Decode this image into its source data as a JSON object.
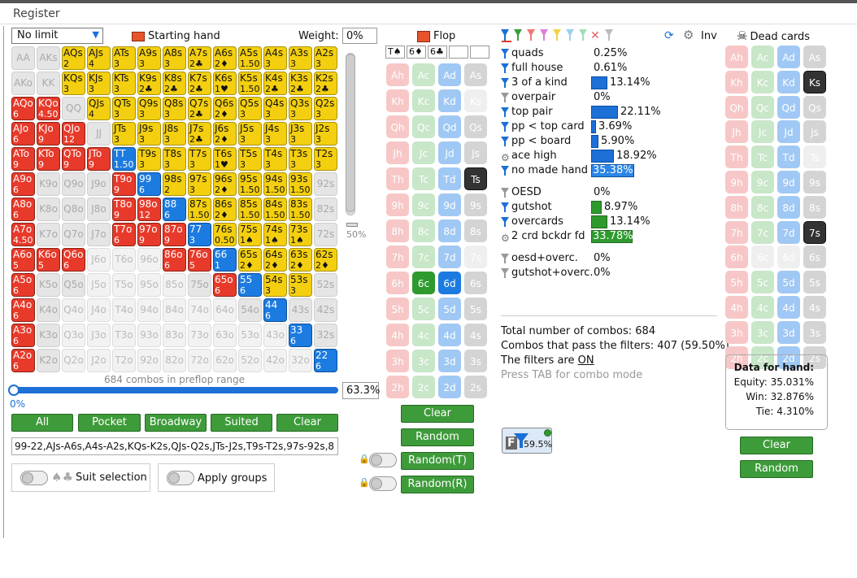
{
  "app": {
    "menu": "Register"
  },
  "controls": {
    "limit": "No limit",
    "starting_hand": "Starting hand",
    "weight_label": "Weight:",
    "weight_value": "0%",
    "percent": "50%",
    "combos_text": "684 combos in preflop range",
    "range_pct": "63.3%",
    "slider_left": "0%",
    "range_string": "99-22,AJs-A6s,A4s-A2s,KQs-K2s,QJs-Q2s,JTs-J2s,T9s-T2s,97s-92s,8",
    "suit_selection": "Suit selection",
    "apply_groups": "Apply groups"
  },
  "buttons": {
    "all": "All",
    "pocket": "Pocket",
    "broadway": "Broadway",
    "suited": "Suited",
    "clear": "Clear",
    "board_clear": "Clear",
    "board_random": "Random",
    "random_t": "Random(T)",
    "random_r": "Random(R)",
    "dead_clear": "Clear",
    "dead_random": "Random"
  },
  "flop": {
    "label": "Flop",
    "cards": [
      "T♠",
      "6♦",
      "6♣",
      "",
      ""
    ]
  },
  "grid": [
    [
      [
        "AA",
        "",
        "gray"
      ],
      [
        "AKs",
        "",
        "gray"
      ],
      [
        "AQs",
        "2",
        "yellow"
      ],
      [
        "AJs",
        "4",
        "yellow"
      ],
      [
        "ATs",
        "3",
        "yellow"
      ],
      [
        "A9s",
        "3",
        "yellow"
      ],
      [
        "A8s",
        "3",
        "yellow"
      ],
      [
        "A7s",
        "2♣",
        "yellow"
      ],
      [
        "A6s",
        "2♦",
        "yellow"
      ],
      [
        "A5s",
        "1.50",
        "yellow"
      ],
      [
        "A4s",
        "3",
        "yellow"
      ],
      [
        "A3s",
        "3",
        "yellow"
      ],
      [
        "A2s",
        "3",
        "yellow"
      ]
    ],
    [
      [
        "AKo",
        "",
        "gray"
      ],
      [
        "KK",
        "",
        "gray"
      ],
      [
        "KQs",
        "3",
        "yellow"
      ],
      [
        "KJs",
        "3",
        "yellow"
      ],
      [
        "KTs",
        "3",
        "yellow"
      ],
      [
        "K9s",
        "2♣",
        "yellow"
      ],
      [
        "K8s",
        "2♣",
        "yellow"
      ],
      [
        "K7s",
        "2♣",
        "yellow"
      ],
      [
        "K6s",
        "1♥",
        "yellow"
      ],
      [
        "K5s",
        "1.50",
        "yellow"
      ],
      [
        "K4s",
        "2♣",
        "yellow"
      ],
      [
        "K3s",
        "2♣",
        "yellow"
      ],
      [
        "K2s",
        "2♣",
        "yellow"
      ]
    ],
    [
      [
        "AQo",
        "6",
        "red"
      ],
      [
        "KQo",
        "4.50",
        "red"
      ],
      [
        "QQ",
        "",
        "gray"
      ],
      [
        "QJs",
        "4",
        "yellow"
      ],
      [
        "QTs",
        "3",
        "yellow"
      ],
      [
        "Q9s",
        "3",
        "yellow"
      ],
      [
        "Q8s",
        "3",
        "yellow"
      ],
      [
        "Q7s",
        "2♣",
        "yellow"
      ],
      [
        "Q6s",
        "2♦",
        "yellow"
      ],
      [
        "Q5s",
        "3",
        "yellow"
      ],
      [
        "Q4s",
        "3",
        "yellow"
      ],
      [
        "Q3s",
        "3",
        "yellow"
      ],
      [
        "Q2s",
        "3",
        "yellow"
      ]
    ],
    [
      [
        "AJo",
        "6",
        "red"
      ],
      [
        "KJo",
        "9",
        "red"
      ],
      [
        "QJo",
        "12",
        "red"
      ],
      [
        "JJ",
        "",
        "gray"
      ],
      [
        "JTs",
        "3",
        "yellow"
      ],
      [
        "J9s",
        "3",
        "yellow"
      ],
      [
        "J8s",
        "3",
        "yellow"
      ],
      [
        "J7s",
        "2♣",
        "yellow"
      ],
      [
        "J6s",
        "2♦",
        "yellow"
      ],
      [
        "J5s",
        "3",
        "yellow"
      ],
      [
        "J4s",
        "3",
        "yellow"
      ],
      [
        "J3s",
        "3",
        "yellow"
      ],
      [
        "J2s",
        "3",
        "yellow"
      ]
    ],
    [
      [
        "ATo",
        "9",
        "red"
      ],
      [
        "KTo",
        "9",
        "red"
      ],
      [
        "QTo",
        "9",
        "red"
      ],
      [
        "JTo",
        "9",
        "red"
      ],
      [
        "TT",
        "1.50",
        "blue"
      ],
      [
        "T9s",
        "3",
        "yellow"
      ],
      [
        "T8s",
        "3",
        "yellow"
      ],
      [
        "T7s",
        "3",
        "yellow"
      ],
      [
        "T6s",
        "1♥",
        "yellow"
      ],
      [
        "T5s",
        "3",
        "yellow"
      ],
      [
        "T4s",
        "3",
        "yellow"
      ],
      [
        "T3s",
        "3",
        "yellow"
      ],
      [
        "T2s",
        "3",
        "yellow"
      ]
    ],
    [
      [
        "A9o",
        "6",
        "red"
      ],
      [
        "K9o",
        "",
        "gray"
      ],
      [
        "Q9o",
        "",
        "gray"
      ],
      [
        "J9o",
        "",
        "gray"
      ],
      [
        "T9o",
        "9",
        "red"
      ],
      [
        "99",
        "6",
        "blue"
      ],
      [
        "98s",
        "2",
        "yellow"
      ],
      [
        "97s",
        "3",
        "yellow"
      ],
      [
        "96s",
        "2♦",
        "yellow"
      ],
      [
        "95s",
        "1.50",
        "yellow"
      ],
      [
        "94s",
        "1.50",
        "yellow"
      ],
      [
        "93s",
        "1.50",
        "yellow"
      ],
      [
        "92s",
        "",
        "gray"
      ]
    ],
    [
      [
        "A8o",
        "6",
        "red"
      ],
      [
        "K8o",
        "",
        "gray"
      ],
      [
        "Q8o",
        "",
        "gray"
      ],
      [
        "J8o",
        "",
        "gray"
      ],
      [
        "T8o",
        "9",
        "red"
      ],
      [
        "98o",
        "12",
        "red"
      ],
      [
        "88",
        "6",
        "blue"
      ],
      [
        "87s",
        "1.50",
        "yellow"
      ],
      [
        "86s",
        "2♦",
        "yellow"
      ],
      [
        "85s",
        "1.50",
        "yellow"
      ],
      [
        "84s",
        "1.50",
        "yellow"
      ],
      [
        "83s",
        "1.50",
        "yellow"
      ],
      [
        "82s",
        "",
        "gray"
      ]
    ],
    [
      [
        "A7o",
        "4.50",
        "red"
      ],
      [
        "K7o",
        "",
        "gray"
      ],
      [
        "Q7o",
        "",
        "gray"
      ],
      [
        "J7o",
        "",
        "gray"
      ],
      [
        "T7o",
        "6",
        "red"
      ],
      [
        "97o",
        "9",
        "red"
      ],
      [
        "87o",
        "9",
        "red"
      ],
      [
        "77",
        "3",
        "blue"
      ],
      [
        "76s",
        "0.50",
        "yellow"
      ],
      [
        "75s",
        "1♠",
        "yellow"
      ],
      [
        "74s",
        "1♠",
        "yellow"
      ],
      [
        "73s",
        "1♠",
        "yellow"
      ],
      [
        "72s",
        "",
        "gray"
      ]
    ],
    [
      [
        "A6o",
        "5",
        "red"
      ],
      [
        "K6o",
        "5",
        "red"
      ],
      [
        "Q6o",
        "6",
        "red"
      ],
      [
        "J6o",
        "",
        "light"
      ],
      [
        "T6o",
        "",
        "light"
      ],
      [
        "96o",
        "",
        "light"
      ],
      [
        "86o",
        "6",
        "red"
      ],
      [
        "76o",
        "5",
        "red"
      ],
      [
        "66",
        "1",
        "blue"
      ],
      [
        "65s",
        "2♦",
        "yellow"
      ],
      [
        "64s",
        "2♦",
        "yellow"
      ],
      [
        "63s",
        "2♦",
        "yellow"
      ],
      [
        "62s",
        "2♦",
        "yellow"
      ]
    ],
    [
      [
        "A5o",
        "6",
        "red"
      ],
      [
        "K5o",
        "",
        "gray"
      ],
      [
        "Q5o",
        "",
        "gray"
      ],
      [
        "J5o",
        "",
        "light"
      ],
      [
        "T5o",
        "",
        "light"
      ],
      [
        "95o",
        "",
        "light"
      ],
      [
        "85o",
        "",
        "light"
      ],
      [
        "75o",
        "",
        "gray"
      ],
      [
        "65o",
        "6",
        "red"
      ],
      [
        "55",
        "6",
        "blue"
      ],
      [
        "54s",
        "3",
        "yellow"
      ],
      [
        "53s",
        "3",
        "yellow"
      ],
      [
        "52s",
        "",
        "gray"
      ]
    ],
    [
      [
        "A4o",
        "6",
        "red"
      ],
      [
        "K4o",
        "",
        "gray"
      ],
      [
        "Q4o",
        "",
        "light"
      ],
      [
        "J4o",
        "",
        "light"
      ],
      [
        "T4o",
        "",
        "light"
      ],
      [
        "94o",
        "",
        "light"
      ],
      [
        "84o",
        "",
        "light"
      ],
      [
        "74o",
        "",
        "light"
      ],
      [
        "64o",
        "",
        "light"
      ],
      [
        "54o",
        "",
        "gray"
      ],
      [
        "44",
        "6",
        "blue"
      ],
      [
        "43s",
        "",
        "gray"
      ],
      [
        "42s",
        "",
        "gray"
      ]
    ],
    [
      [
        "A3o",
        "6",
        "red"
      ],
      [
        "K3o",
        "",
        "gray"
      ],
      [
        "Q3o",
        "",
        "light"
      ],
      [
        "J3o",
        "",
        "light"
      ],
      [
        "T3o",
        "",
        "light"
      ],
      [
        "93o",
        "",
        "light"
      ],
      [
        "83o",
        "",
        "light"
      ],
      [
        "73o",
        "",
        "light"
      ],
      [
        "63o",
        "",
        "light"
      ],
      [
        "53o",
        "",
        "light"
      ],
      [
        "43o",
        "",
        "light"
      ],
      [
        "33",
        "6",
        "blue"
      ],
      [
        "32s",
        "",
        "gray"
      ]
    ],
    [
      [
        "A2o",
        "6",
        "red"
      ],
      [
        "K2o",
        "",
        "gray"
      ],
      [
        "Q2o",
        "",
        "light"
      ],
      [
        "J2o",
        "",
        "light"
      ],
      [
        "T2o",
        "",
        "light"
      ],
      [
        "92o",
        "",
        "light"
      ],
      [
        "82o",
        "",
        "light"
      ],
      [
        "72o",
        "",
        "light"
      ],
      [
        "62o",
        "",
        "light"
      ],
      [
        "52o",
        "",
        "light"
      ],
      [
        "42o",
        "",
        "light"
      ],
      [
        "32o",
        "",
        "light"
      ],
      [
        "22",
        "6",
        "blue"
      ]
    ]
  ],
  "board_cards": [
    [
      [
        "Ah",
        "c-h"
      ],
      [
        "Ac",
        "c-c"
      ],
      [
        "Ad",
        "c-d"
      ],
      [
        "As",
        "c-s"
      ]
    ],
    [
      [
        "Kh",
        "c-h"
      ],
      [
        "Kc",
        "c-c"
      ],
      [
        "Kd",
        "c-d"
      ],
      [
        "Ks",
        "c-ghost"
      ]
    ],
    [
      [
        "Qh",
        "c-h"
      ],
      [
        "Qc",
        "c-c"
      ],
      [
        "Qd",
        "c-d"
      ],
      [
        "Qs",
        "c-s"
      ]
    ],
    [
      [
        "Jh",
        "c-h"
      ],
      [
        "Jc",
        "c-c"
      ],
      [
        "Jd",
        "c-d"
      ],
      [
        "Js",
        "c-s"
      ]
    ],
    [
      [
        "Th",
        "c-h"
      ],
      [
        "Tc",
        "c-c"
      ],
      [
        "Td",
        "c-d"
      ],
      [
        "Ts",
        "c-dark"
      ]
    ],
    [
      [
        "9h",
        "c-h"
      ],
      [
        "9c",
        "c-c"
      ],
      [
        "9d",
        "c-d"
      ],
      [
        "9s",
        "c-s"
      ]
    ],
    [
      [
        "8h",
        "c-h"
      ],
      [
        "8c",
        "c-c"
      ],
      [
        "8d",
        "c-d"
      ],
      [
        "8s",
        "c-s"
      ]
    ],
    [
      [
        "7h",
        "c-h"
      ],
      [
        "7c",
        "c-c"
      ],
      [
        "7d",
        "c-d"
      ],
      [
        "7s",
        "c-ghost"
      ]
    ],
    [
      [
        "6h",
        "c-h"
      ],
      [
        "6c",
        "c-green"
      ],
      [
        "6d",
        "c-blue"
      ],
      [
        "6s",
        "c-s"
      ]
    ],
    [
      [
        "5h",
        "c-h"
      ],
      [
        "5c",
        "c-c"
      ],
      [
        "5d",
        "c-d"
      ],
      [
        "5s",
        "c-s"
      ]
    ],
    [
      [
        "4h",
        "c-h"
      ],
      [
        "4c",
        "c-c"
      ],
      [
        "4d",
        "c-d"
      ],
      [
        "4s",
        "c-s"
      ]
    ],
    [
      [
        "3h",
        "c-h"
      ],
      [
        "3c",
        "c-c"
      ],
      [
        "3d",
        "c-d"
      ],
      [
        "3s",
        "c-s"
      ]
    ],
    [
      [
        "2h",
        "c-h"
      ],
      [
        "2c",
        "c-c"
      ],
      [
        "2d",
        "c-d"
      ],
      [
        "2s",
        "c-s"
      ]
    ]
  ],
  "dead_cards": {
    "label": "Dead cards",
    "cards": [
      [
        [
          "Ah",
          "c-h"
        ],
        [
          "Ac",
          "c-c"
        ],
        [
          "Ad",
          "c-d"
        ],
        [
          "As",
          "c-s"
        ]
      ],
      [
        [
          "Kh",
          "c-h"
        ],
        [
          "Kc",
          "c-c"
        ],
        [
          "Kd",
          "c-d"
        ],
        [
          "Ks",
          "c-dark"
        ]
      ],
      [
        [
          "Qh",
          "c-h"
        ],
        [
          "Qc",
          "c-c"
        ],
        [
          "Qd",
          "c-d"
        ],
        [
          "Qs",
          "c-s"
        ]
      ],
      [
        [
          "Jh",
          "c-h"
        ],
        [
          "Jc",
          "c-c"
        ],
        [
          "Jd",
          "c-d"
        ],
        [
          "Js",
          "c-s"
        ]
      ],
      [
        [
          "Th",
          "c-h"
        ],
        [
          "Tc",
          "c-c"
        ],
        [
          "Td",
          "c-d"
        ],
        [
          "Ts",
          "c-ghost"
        ]
      ],
      [
        [
          "9h",
          "c-h"
        ],
        [
          "9c",
          "c-c"
        ],
        [
          "9d",
          "c-d"
        ],
        [
          "9s",
          "c-s"
        ]
      ],
      [
        [
          "8h",
          "c-h"
        ],
        [
          "8c",
          "c-c"
        ],
        [
          "8d",
          "c-d"
        ],
        [
          "8s",
          "c-s"
        ]
      ],
      [
        [
          "7h",
          "c-h"
        ],
        [
          "7c",
          "c-c"
        ],
        [
          "7d",
          "c-d"
        ],
        [
          "7s",
          "c-dark"
        ]
      ],
      [
        [
          "6h",
          "c-h"
        ],
        [
          "6c",
          "c-ghost"
        ],
        [
          "6d",
          "c-ghost"
        ],
        [
          "6s",
          "c-s"
        ]
      ],
      [
        [
          "5h",
          "c-h"
        ],
        [
          "5c",
          "c-c"
        ],
        [
          "5d",
          "c-d"
        ],
        [
          "5s",
          "c-s"
        ]
      ],
      [
        [
          "4h",
          "c-h"
        ],
        [
          "4c",
          "c-c"
        ],
        [
          "4d",
          "c-d"
        ],
        [
          "4s",
          "c-s"
        ]
      ],
      [
        [
          "3h",
          "c-h"
        ],
        [
          "3c",
          "c-c"
        ],
        [
          "3d",
          "c-d"
        ],
        [
          "3s",
          "c-s"
        ]
      ],
      [
        [
          "2h",
          "c-h"
        ],
        [
          "2c",
          "c-c"
        ],
        [
          "2d",
          "c-d"
        ],
        [
          "2s",
          "c-s"
        ]
      ]
    ]
  },
  "filters": {
    "inv": "Inv",
    "items": [
      {
        "name": "quads",
        "pct": "0.25%",
        "frac": 0.0025,
        "bar": "none"
      },
      {
        "name": "full house",
        "pct": "0.61%",
        "frac": 0.0061,
        "bar": "none"
      },
      {
        "name": "3 of a kind",
        "pct": "13.14%",
        "frac": 0.1314,
        "bar": "blue"
      },
      {
        "name": "overpair",
        "pct": "0%",
        "frac": 0,
        "bar": "none"
      },
      {
        "name": "top pair",
        "pct": "22.11%",
        "frac": 0.2211,
        "bar": "blue"
      },
      {
        "name": "pp < top card",
        "pct": "3.69%",
        "frac": 0.0369,
        "bar": "blue"
      },
      {
        "name": "pp < board",
        "pct": "5.90%",
        "frac": 0.059,
        "bar": "blue"
      },
      {
        "name": "ace high",
        "pct": "18.92%",
        "frac": 0.1892,
        "bar": "blue"
      },
      {
        "name": "no made hand",
        "pct": "35.38%",
        "frac": 0.3538,
        "bar": "blue2"
      },
      {
        "name": "OESD",
        "pct": "0%",
        "frac": 0,
        "bar": "none"
      },
      {
        "name": "gutshot",
        "pct": "8.97%",
        "frac": 0.0897,
        "bar": "green"
      },
      {
        "name": "overcards",
        "pct": "13.14%",
        "frac": 0.1314,
        "bar": "green"
      },
      {
        "name": "2 crd bckdr fd",
        "pct": "33.78%",
        "frac": 0.3378,
        "bar": "green"
      },
      {
        "name": "oesd+overc.",
        "pct": "0%",
        "frac": 0,
        "bar": "none"
      },
      {
        "name": "gutshot+overc.",
        "pct": "0%",
        "frac": 0,
        "bar": "none"
      }
    ]
  },
  "stats": {
    "total": "Total number of combos: 684",
    "pass": "Combos that pass the filters: 407 (59.50%)",
    "filters_on_prefix": "The filters are ",
    "filters_on": "ON",
    "hint": "Press TAB for combo mode",
    "badge_pct": "59.5%",
    "badge_letter": "F"
  },
  "hand_data": {
    "title": "Data for hand:",
    "equity": "Equity: 35.031%",
    "win": "Win: 32.876%",
    "tie": "Tie: 4.310%"
  }
}
